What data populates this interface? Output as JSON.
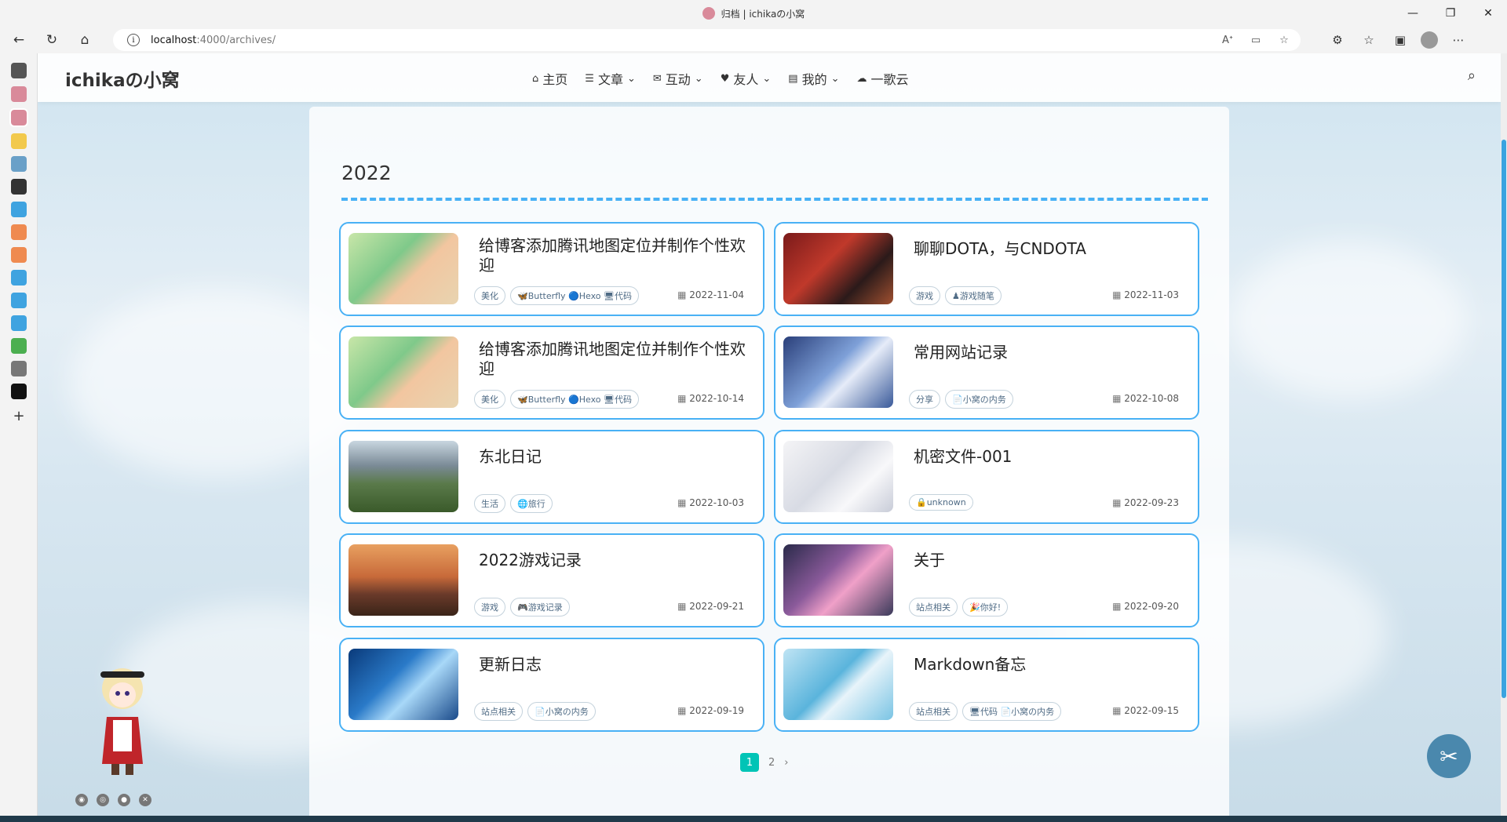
{
  "window": {
    "title": "归档 | ichikaの小窝"
  },
  "browser": {
    "url_host": "localhost",
    "url_path": ":4000/archives/",
    "url_label": "ⓘ"
  },
  "site": {
    "logo": "ichikaの小窝",
    "menu": [
      {
        "label": "主页",
        "icon": "⌂"
      },
      {
        "label": "文章",
        "icon": "☰"
      },
      {
        "label": "互动",
        "icon": "✉"
      },
      {
        "label": "友人",
        "icon": "♥"
      },
      {
        "label": "我的",
        "icon": "▤"
      },
      {
        "label": "一歌云",
        "icon": "☁"
      }
    ],
    "search_icon": "⌕"
  },
  "archive": {
    "year": "2022",
    "posts": [
      {
        "title": "给博客添加腾讯地图定位并制作个性欢迎",
        "tags": [
          "美化",
          "🦋Butterfly 🔵Hexo 🖥代码"
        ],
        "date": "2022-11-04",
        "thumb": "green-anime"
      },
      {
        "title": "聊聊DOTA，与CNDOTA",
        "tags": [
          "游戏",
          "♟游戏随笔"
        ],
        "date": "2022-11-03",
        "thumb": "red-stage"
      },
      {
        "title": "给博客添加腾讯地图定位并制作个性欢迎",
        "tags": [
          "美化",
          "🦋Butterfly 🔵Hexo 🖥代码"
        ],
        "date": "2022-10-14",
        "thumb": "green-anime"
      },
      {
        "title": "常用网站记录",
        "tags": [
          "分享",
          "📄小窝の内务"
        ],
        "date": "2022-10-08",
        "thumb": "blue-angel"
      },
      {
        "title": "东北日记",
        "tags": [
          "生活",
          "🌐旅行"
        ],
        "date": "2022-10-03",
        "thumb": "mountain-lake"
      },
      {
        "title": "机密文件-001",
        "tags": [
          "🔒unknown"
        ],
        "date": "2022-09-23",
        "thumb": "white-sketch"
      },
      {
        "title": "2022游戏记录",
        "tags": [
          "游戏",
          "🎮游戏记录"
        ],
        "date": "2022-09-21",
        "thumb": "sunset"
      },
      {
        "title": "关于",
        "tags": [
          "站点相关",
          "🎉你好!"
        ],
        "date": "2022-09-20",
        "thumb": "pink-guitar"
      },
      {
        "title": "更新日志",
        "tags": [
          "站点相关",
          "📄小窝の内务"
        ],
        "date": "2022-09-19",
        "thumb": "deep-blue"
      },
      {
        "title": "Markdown备忘",
        "tags": [
          "站点相关",
          "🖥代码 📄小窝の内务"
        ],
        "date": "2022-09-15",
        "thumb": "miku"
      }
    ]
  },
  "pagination": {
    "current": "1",
    "next_page": "2",
    "next_icon": "›"
  },
  "fab_icon": "✂",
  "taskbar_time": ""
}
